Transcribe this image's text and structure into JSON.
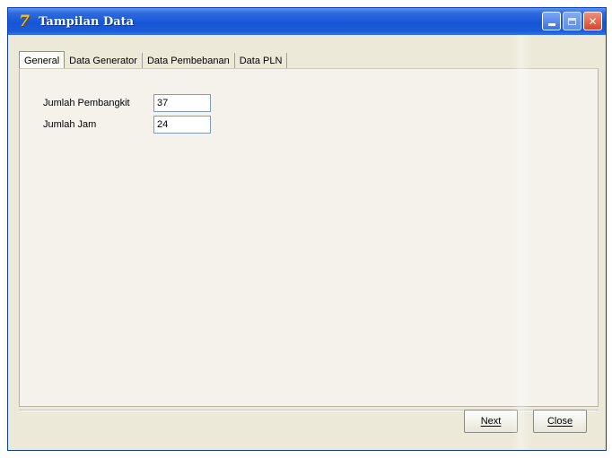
{
  "window": {
    "title": "Tampilan Data",
    "icon": "app-logo-icon",
    "title_color": "#ffffff",
    "titlebar_color": "#1656d6"
  },
  "tabs": [
    {
      "label": "General",
      "active": true
    },
    {
      "label": "Data Generator",
      "active": false
    },
    {
      "label": "Data Pembebanan",
      "active": false
    },
    {
      "label": "Data PLN",
      "active": false
    }
  ],
  "general": {
    "jumlah_pembangkit": {
      "label": "Jumlah Pembangkit",
      "value": "37"
    },
    "jumlah_jam": {
      "label": "Jumlah Jam",
      "value": "24"
    }
  },
  "buttons": {
    "next": "Next",
    "close": "Close"
  }
}
